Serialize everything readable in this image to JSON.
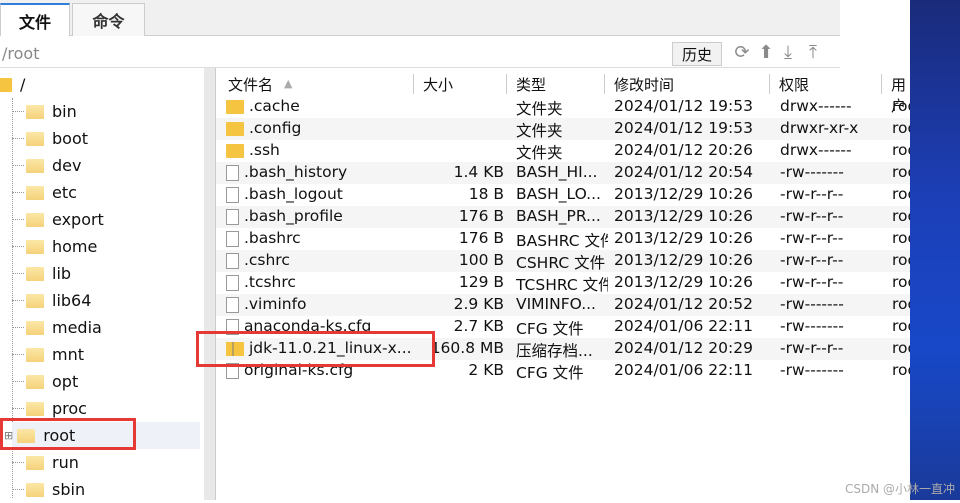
{
  "tabs": [
    {
      "label": "文件",
      "active": true
    },
    {
      "label": "命令",
      "active": false
    }
  ],
  "path": "/root",
  "toolbar": {
    "history_label": "历史",
    "icons": [
      "refresh-icon",
      "up-icon",
      "download-icon",
      "upload-icon"
    ]
  },
  "tree": {
    "root": "/",
    "items": [
      "bin",
      "boot",
      "dev",
      "etc",
      "export",
      "home",
      "lib",
      "lib64",
      "media",
      "mnt",
      "opt",
      "proc",
      "root",
      "run",
      "sbin"
    ],
    "selected": "root"
  },
  "columns": [
    "文件名",
    "大小",
    "类型",
    "修改时间",
    "权限",
    "用户"
  ],
  "files": [
    {
      "name": ".cache",
      "size": "",
      "type": "文件夹",
      "mtime": "2024/01/12 19:53",
      "perm": "drwx------",
      "user": "root",
      "icon": "folder"
    },
    {
      "name": ".config",
      "size": "",
      "type": "文件夹",
      "mtime": "2024/01/12 19:53",
      "perm": "drwxr-xr-x",
      "user": "root",
      "icon": "folder"
    },
    {
      "name": ".ssh",
      "size": "",
      "type": "文件夹",
      "mtime": "2024/01/12 20:26",
      "perm": "drwx------",
      "user": "root",
      "icon": "folder"
    },
    {
      "name": ".bash_history",
      "size": "1.4 KB",
      "type": "BASH_HI...",
      "mtime": "2024/01/12 20:54",
      "perm": "-rw-------",
      "user": "root",
      "icon": "file"
    },
    {
      "name": ".bash_logout",
      "size": "18 B",
      "type": "BASH_LO...",
      "mtime": "2013/12/29 10:26",
      "perm": "-rw-r--r--",
      "user": "root",
      "icon": "file"
    },
    {
      "name": ".bash_profile",
      "size": "176 B",
      "type": "BASH_PR...",
      "mtime": "2013/12/29 10:26",
      "perm": "-rw-r--r--",
      "user": "root",
      "icon": "file"
    },
    {
      "name": ".bashrc",
      "size": "176 B",
      "type": "BASHRC 文件",
      "mtime": "2013/12/29 10:26",
      "perm": "-rw-r--r--",
      "user": "root",
      "icon": "file"
    },
    {
      "name": ".cshrc",
      "size": "100 B",
      "type": "CSHRC 文件",
      "mtime": "2013/12/29 10:26",
      "perm": "-rw-r--r--",
      "user": "root",
      "icon": "file"
    },
    {
      "name": ".tcshrc",
      "size": "129 B",
      "type": "TCSHRC 文件",
      "mtime": "2013/12/29 10:26",
      "perm": "-rw-r--r--",
      "user": "root",
      "icon": "file"
    },
    {
      "name": ".viminfo",
      "size": "2.9 KB",
      "type": "VIMINFO...",
      "mtime": "2024/01/12 20:52",
      "perm": "-rw-------",
      "user": "root",
      "icon": "file"
    },
    {
      "name": "anaconda-ks.cfg",
      "size": "2.7 KB",
      "type": "CFG 文件",
      "mtime": "2024/01/06 22:11",
      "perm": "-rw-------",
      "user": "root",
      "icon": "file"
    },
    {
      "name": "jdk-11.0.21_linux-x...",
      "size": "160.8 MB",
      "type": "压缩存档...",
      "mtime": "2024/01/12 20:29",
      "perm": "-rw-r--r--",
      "user": "root",
      "icon": "zip"
    },
    {
      "name": "original-ks.cfg",
      "size": "2 KB",
      "type": "CFG 文件",
      "mtime": "2024/01/06 22:11",
      "perm": "-rw-------",
      "user": "root",
      "icon": "file"
    }
  ],
  "highlight_color": "#e53935",
  "watermark": "CSDN @小林一直冲"
}
